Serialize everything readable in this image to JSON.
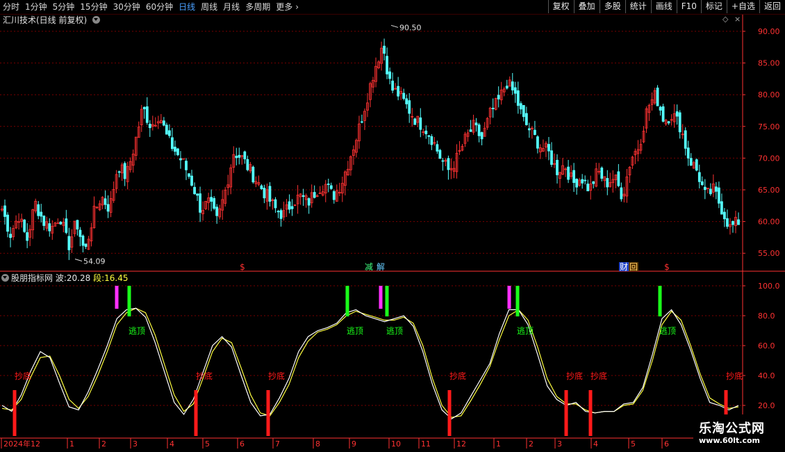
{
  "toolbar": {
    "periods": [
      "分时",
      "1分钟",
      "5分钟",
      "15分钟",
      "30分钟",
      "60分钟",
      "日线",
      "周线",
      "月线",
      "多周期",
      "更多"
    ],
    "active_period": "日线",
    "more_chevron": "›",
    "buttons": [
      "复权",
      "叠加",
      "多股",
      "统计",
      "画线",
      "F10",
      "标记",
      "+自选",
      "返回"
    ]
  },
  "main_panel": {
    "title": "汇川技术(日线 前复权)",
    "high_marker": "90.50",
    "low_marker": "54.09",
    "event_markers": [
      "$",
      "减",
      "解",
      "财",
      "回",
      "$"
    ]
  },
  "indicator_panel": {
    "name": "股朋指标网",
    "wave_label": "波:",
    "wave_value": "20.28",
    "seg_label": "段:",
    "seg_value": "16.45",
    "signal_buy": "抄底",
    "signal_sell": "逃顶"
  },
  "x_axis": {
    "labels": [
      "2024年12",
      "1",
      "2",
      "3",
      "4",
      "5",
      "6",
      "7",
      "8",
      "9",
      "10",
      "11",
      "12",
      "1",
      "2",
      "3",
      "4",
      "5",
      "6"
    ]
  },
  "watermark": {
    "line1": "乐淘公式网",
    "line2": "www.60lt.com"
  },
  "colors": {
    "up": "#ff3232",
    "down": "#54ffff",
    "grid": "#7a0000",
    "axis": "#ff3232",
    "wave": "#ffffff",
    "seg": "#ffff40",
    "buy": "#ff1a1a",
    "sell": "#1aff1a",
    "top": "#ff30ff"
  },
  "chart_data": [
    {
      "type": "candlestick",
      "title": "汇川技术(日线 前复权)",
      "y_ticks": [
        55.0,
        60.0,
        65.0,
        70.0,
        75.0,
        80.0,
        85.0,
        90.0
      ],
      "ylim": [
        52.0,
        92.5
      ],
      "labeled_high": 90.5,
      "labeled_low": 54.09,
      "close_path": [
        62,
        58,
        61,
        57,
        63,
        60,
        59,
        61,
        56,
        60,
        55,
        61,
        64,
        62,
        69,
        67,
        72,
        78,
        75,
        77,
        73,
        71,
        69,
        66,
        62,
        63,
        60,
        65,
        71,
        70,
        68,
        66,
        64,
        62,
        61,
        63,
        64,
        63,
        65,
        66,
        64,
        66,
        70,
        74,
        79,
        84,
        88,
        81,
        80,
        78,
        76,
        75,
        73,
        70,
        68,
        70,
        73,
        75,
        73,
        77,
        79,
        82,
        80,
        76,
        74,
        72,
        71,
        68,
        69,
        66,
        67,
        65,
        68,
        66,
        67,
        64,
        70,
        72,
        78,
        80,
        76,
        77,
        75,
        70,
        68,
        64,
        65,
        62,
        59,
        60
      ],
      "series": [
        {
          "name": "波",
          "values": [
            20,
            16,
            27,
            43,
            56,
            52,
            35,
            19,
            17,
            29,
            44,
            60,
            78,
            84,
            85,
            79,
            62,
            42,
            22,
            14,
            24,
            42,
            60,
            66,
            59,
            40,
            22,
            13,
            14,
            25,
            38,
            56,
            66,
            70,
            72,
            75,
            82,
            84,
            80,
            78,
            76,
            78,
            80,
            73,
            56,
            34,
            17,
            11,
            15,
            26,
            37,
            48,
            68,
            84,
            84,
            74,
            54,
            33,
            24,
            20,
            22,
            16,
            15,
            16,
            16,
            21,
            22,
            32,
            54,
            78,
            84,
            74,
            57,
            38,
            22,
            20,
            17,
            20
          ]
        },
        {
          "name": "段",
          "values": [
            18,
            17,
            24,
            39,
            52,
            53,
            40,
            24,
            18,
            26,
            40,
            56,
            74,
            82,
            85,
            82,
            67,
            47,
            27,
            16,
            21,
            38,
            56,
            65,
            62,
            45,
            27,
            15,
            13,
            22,
            34,
            52,
            63,
            69,
            71,
            74,
            80,
            83,
            81,
            79,
            77,
            77,
            79,
            75,
            60,
            38,
            20,
            12,
            13,
            23,
            34,
            46,
            64,
            80,
            84,
            77,
            59,
            38,
            26,
            21,
            21,
            17,
            15,
            16,
            16,
            20,
            21,
            30,
            50,
            74,
            83,
            77,
            60,
            41,
            25,
            21,
            18,
            19
          ]
        }
      ],
      "ind_y_ticks": [
        20.0,
        40.0,
        60.0,
        80.0,
        100.0
      ]
    }
  ]
}
